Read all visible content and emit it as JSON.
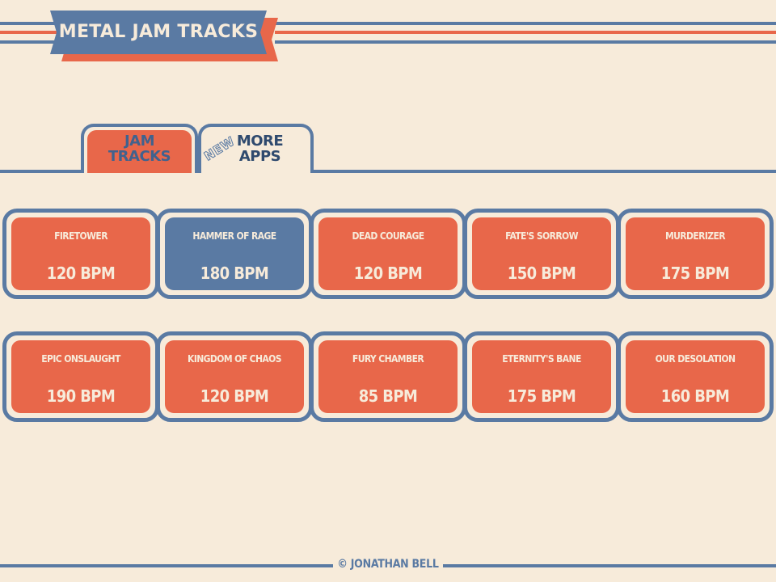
{
  "app": {
    "title": "METAL JAM TRACKS"
  },
  "tabs": [
    {
      "label": "JAM TRACKS",
      "line1": "JAM",
      "line2": "TRACKS",
      "active": true
    },
    {
      "label": "MORE APPS",
      "line1": "MORE",
      "line2": "APPS",
      "badge": "NEW",
      "active": false
    }
  ],
  "tracks": [
    {
      "name": "FIRETOWER",
      "bpm": "120 BPM"
    },
    {
      "name": "HAMMER OF RAGE",
      "bpm": "180 BPM",
      "selected": true
    },
    {
      "name": "DEAD COURAGE",
      "bpm": "120 BPM"
    },
    {
      "name": "FATE'S SORROW",
      "bpm": "150 BPM"
    },
    {
      "name": "MURDERIZER",
      "bpm": "175 BPM"
    },
    {
      "name": "EPIC ONSLAUGHT",
      "bpm": "190 BPM"
    },
    {
      "name": "KINGDOM OF CHAOS",
      "bpm": "120 BPM"
    },
    {
      "name": "FURY CHAMBER",
      "bpm": "85 BPM"
    },
    {
      "name": "ETERNITY'S BANE",
      "bpm": "175 BPM"
    },
    {
      "name": "OUR DESOLATION",
      "bpm": "160 BPM"
    }
  ],
  "footer": {
    "credit": "© JONATHAN BELL"
  },
  "colors": {
    "background": "#f7ebda",
    "blue": "#5a7aa3",
    "red": "#e8674a",
    "navy": "#2f4a6e"
  }
}
